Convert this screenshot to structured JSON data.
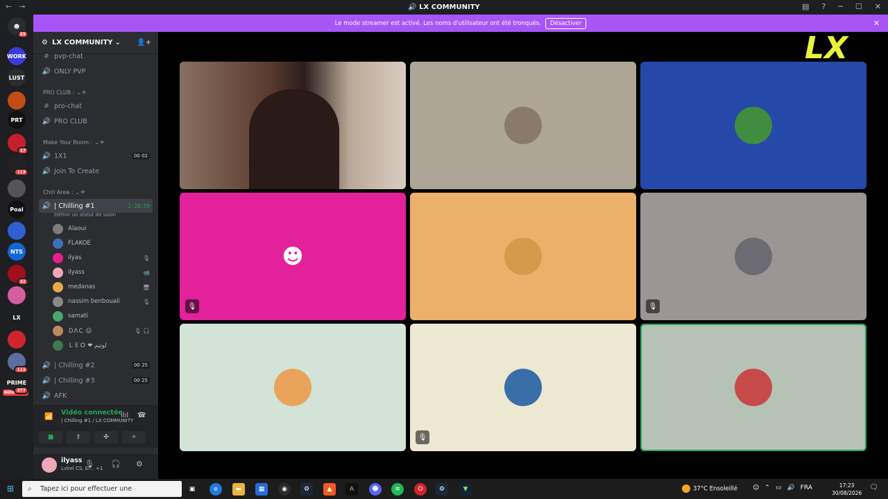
{
  "window": {
    "title": "LX COMMUNITY"
  },
  "banner": {
    "message": "Le mode streamer est activé. Les noms d'utilisateur ont été tronqués.",
    "button": "Désactiver",
    "bg_color": "#a855f7"
  },
  "guild_rail": {
    "home_badge": "25",
    "servers": [
      {
        "label": "WORK",
        "color": "#3b3bd6"
      },
      {
        "label": "LUST",
        "color": "#2b2d31"
      },
      {
        "label": "",
        "color": "#c24c16"
      },
      {
        "label": "PRT",
        "color": "#111111",
        "badge": ""
      },
      {
        "label": "",
        "color": "#c61f2f",
        "badge": "17"
      },
      {
        "label": "",
        "color": "#222222",
        "badge": "113"
      },
      {
        "label": "",
        "color": "#555555"
      },
      {
        "label": "Poal",
        "color": "#111111"
      },
      {
        "label": "",
        "color": "#2f5fd0"
      },
      {
        "label": "NTS",
        "color": "#1366d6"
      },
      {
        "label": "",
        "color": "#a00f1c",
        "badge": "32"
      },
      {
        "label": "",
        "color": "#d35fa2"
      },
      {
        "label": "LX",
        "color": "#1e1f22"
      },
      {
        "label": "",
        "color": "#d0242c"
      },
      {
        "label": "",
        "color": "#5a6ea0",
        "badge": "111"
      },
      {
        "label": "PRIME",
        "color": "#222",
        "badge": "377"
      }
    ],
    "new_label": "NOUVEAU"
  },
  "sidebar": {
    "server_name": "LX COMMUNITY",
    "items": [
      {
        "type": "text",
        "name": "pvp-chat"
      },
      {
        "type": "voice",
        "name": "ONLY PVP"
      },
      {
        "type": "category",
        "name": "PRO CLUB :"
      },
      {
        "type": "text",
        "name": "pro-chat"
      },
      {
        "type": "voice",
        "name": "PRO CLUB"
      },
      {
        "type": "category",
        "name": "Make Your Room :"
      },
      {
        "type": "voice",
        "name": "1X1",
        "count": "00  02"
      },
      {
        "type": "voice",
        "name": "Join To Create"
      },
      {
        "type": "category",
        "name": "Chill Area :"
      }
    ],
    "active_channel": {
      "name": "| Chilling #1",
      "timer": "2:28:59",
      "status_hint": "Définir un statut de salon"
    },
    "members": [
      {
        "name": "Alaoui",
        "color": "#7d7d7d",
        "icons": ""
      },
      {
        "name": "FLAKOE",
        "color": "#3a70b8",
        "icons": ""
      },
      {
        "name": "ilyas",
        "color": "#e91e8c",
        "icons": "🎙"
      },
      {
        "name": "ilyass",
        "color": "#f0a7b9",
        "icons": "📹"
      },
      {
        "name": "medanas",
        "color": "#e8a848",
        "icons": "🖥"
      },
      {
        "name": "nassim benbouali",
        "color": "#8a8a8a",
        "icons": "🎙"
      },
      {
        "name": "samati",
        "color": "#4aa56b",
        "icons": ""
      },
      {
        "name": "ＤΛＣ ☺",
        "color": "#c08a60",
        "icons": "🎙 🎧"
      },
      {
        "name": "ＬＥＯ ❤ ﻟﻮﺗﻴﻢ",
        "color": "#3d7a4d",
        "icons": ""
      }
    ],
    "more_channels": [
      {
        "name": "| Chilling #2",
        "count": "00  25"
      },
      {
        "name": "| Chilling #3",
        "count": "00  25"
      },
      {
        "name": "AFK",
        "count": ""
      }
    ]
  },
  "voice_panel": {
    "status": "Vidéo connectée",
    "channel": "| Chilling #1 / LX COMMUNITY"
  },
  "user_panel": {
    "username": "ilyass",
    "status": "Lvbel CS, El... +1"
  },
  "stage": {
    "logo_text": "LX",
    "tiles": [
      {
        "bg": "#6b4a3e",
        "kind": "camera",
        "muted": false
      },
      {
        "bg": "#ada595",
        "kind": "avatar",
        "avatar_color": "#8a7a6a",
        "muted": false
      },
      {
        "bg": "#2549a8",
        "kind": "avatar",
        "avatar_color": "#3f8d3f",
        "muted": false
      },
      {
        "bg": "#e2219b",
        "kind": "discord",
        "muted": true
      },
      {
        "bg": "#ebb06a",
        "kind": "avatar",
        "avatar_color": "#d59a4a",
        "muted": false
      },
      {
        "bg": "#9b9693",
        "kind": "avatar",
        "avatar_color": "#6c6a72",
        "muted": true
      },
      {
        "bg": "#d2e3d8",
        "kind": "avatar",
        "avatar_color": "#eaa35b",
        "muted": false
      },
      {
        "bg": "#ede8d2",
        "kind": "avatar",
        "avatar_color": "#3a6ea8",
        "muted": true
      },
      {
        "bg": "#b6c2b6",
        "kind": "avatar",
        "avatar_color": "#c64a4a",
        "muted": false,
        "speaking": true
      }
    ]
  },
  "taskbar": {
    "search_placeholder": "Tapez ici pour effectuer une",
    "weather": "37°C  Ensoleillé",
    "lang": "FRA",
    "time": "17:23",
    "date": "30/08/2026"
  }
}
